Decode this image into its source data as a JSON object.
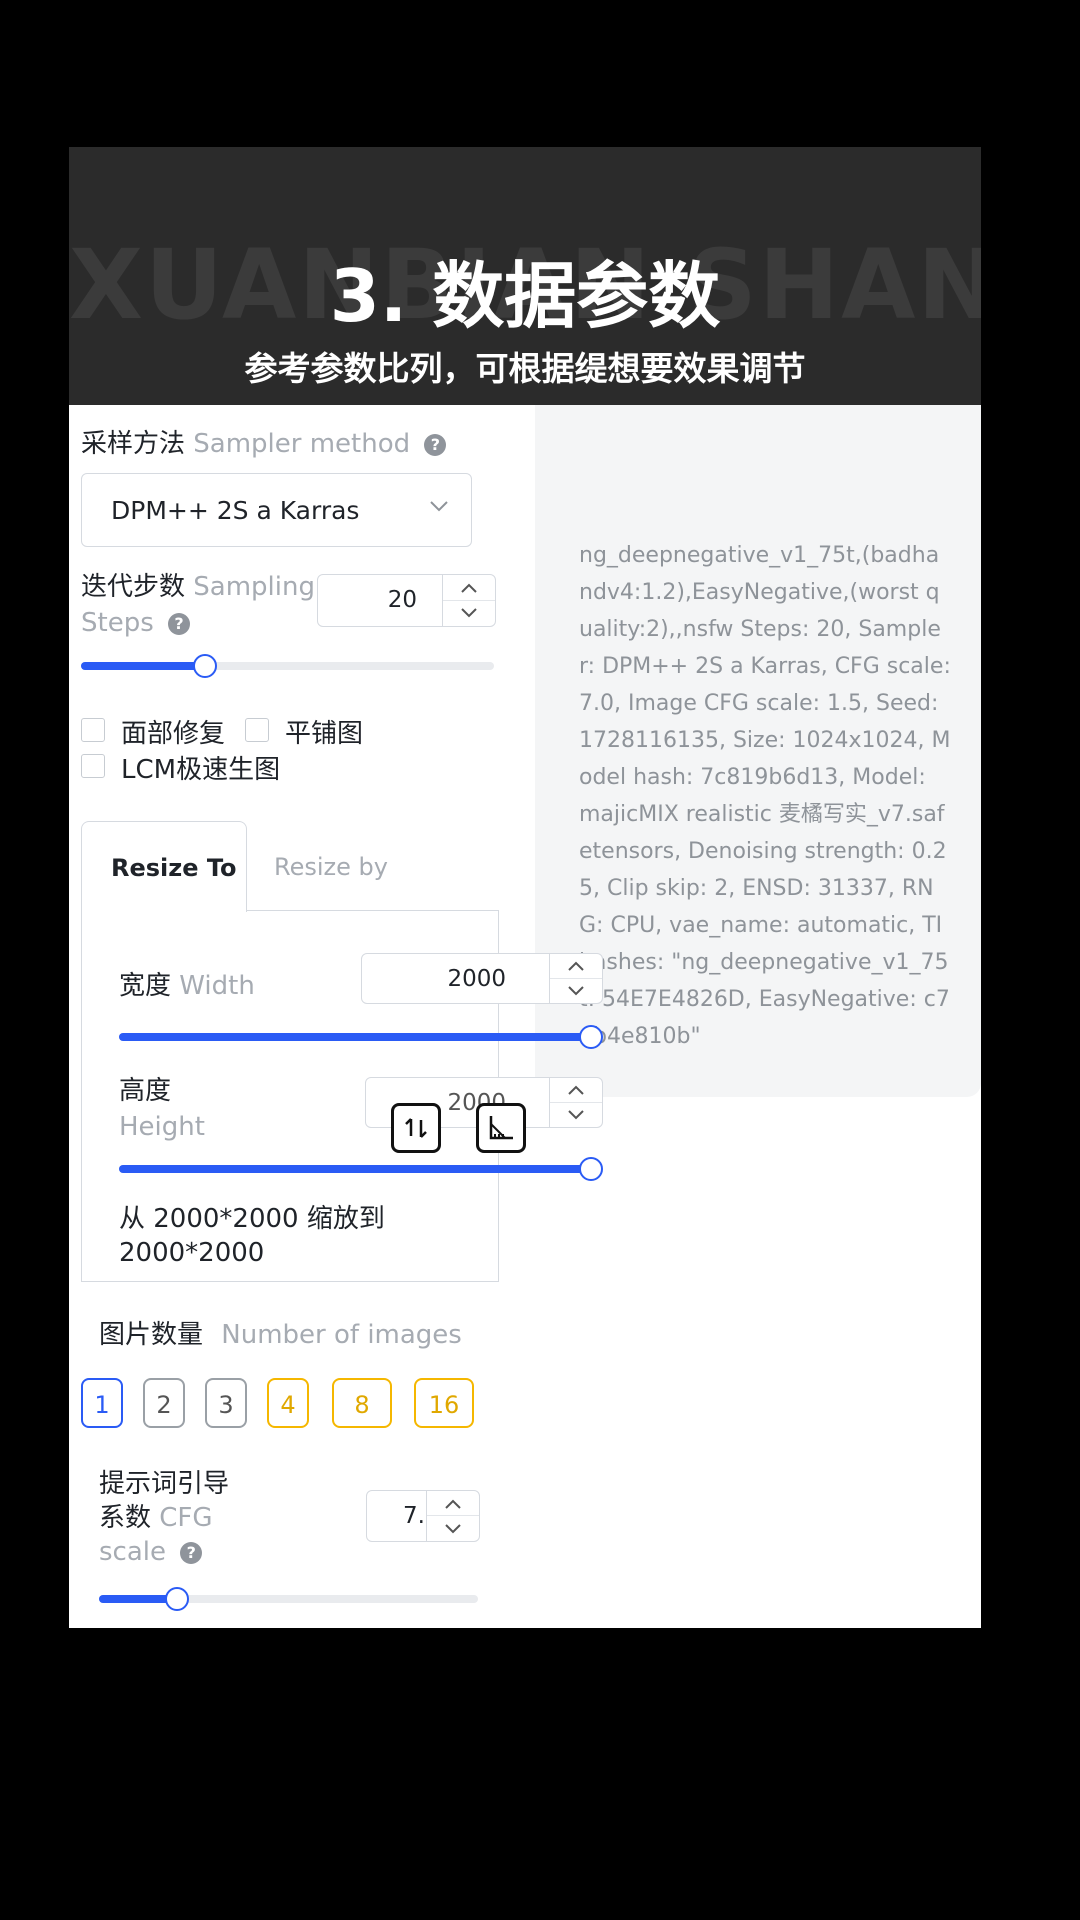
{
  "banner": {
    "watermark": "XUANBIAN SHANM",
    "title": "3. 数据参数",
    "subtitle": "参考参数比列，可根据缇想要效果调节"
  },
  "info": {
    "text": "ng_deepnegative_v1_75t,(badhandv4:1.2),EasyNegative,(worst quality:2),,nsfw Steps: 20, Sampler: DPM++ 2S a Karras, CFG scale: 7.0, Image CFG scale: 1.5, Seed: 1728116135, Size: 1024x1024, Model hash: 7c819b6d13, Model: majicMIX realistic 麦橘写实_v7.safetensors, Denoising strength: 0.25, Clip skip: 2, ENSD: 31337, RNG: CPU, vae_name: automatic, TI hashes: \"ng_deepnegative_v1_75t: 54E7E4826D, EasyNegative: c74b4e810b\""
  },
  "sampler": {
    "label_cn": "采样方法",
    "label_en": "Sampler method",
    "help": "?",
    "value": "DPM++ 2S a Karras"
  },
  "steps": {
    "label_cn": "迭代步数",
    "label_en_1": "Sampling",
    "label_en_2": "Steps",
    "help": "?",
    "value": "20",
    "slider_fraction": 0.3
  },
  "checkboxes": {
    "face_restore": "面部修复",
    "tiling": "平铺图",
    "lcm": "LCM极速生图"
  },
  "tabs": {
    "resize_to": "Resize To",
    "resize_by": "Resize by"
  },
  "width": {
    "label_cn": "宽度",
    "label_en": "Width",
    "value": "2000",
    "slider_fraction": 1.0
  },
  "height": {
    "label_cn": "高度",
    "label_en": "Height",
    "value": "2000",
    "slider_fraction": 1.0
  },
  "resize_note": {
    "line1": "从 2000*2000 缩放到",
    "line2": "2000*2000"
  },
  "images": {
    "label_cn": "图片数量",
    "label_en": "Number of images",
    "options": [
      "1",
      "2",
      "3",
      "4",
      "8",
      "16"
    ],
    "selected": "1"
  },
  "cfg": {
    "label_cn_1": "提示词引导",
    "label_cn_2": "系数",
    "label_en_1": "CFG",
    "label_en_2": "scale",
    "help": "?",
    "value": "7.",
    "slider_fraction": 0.2
  },
  "colors": {
    "accent": "#2a5bf5",
    "warning": "#f5b700"
  }
}
